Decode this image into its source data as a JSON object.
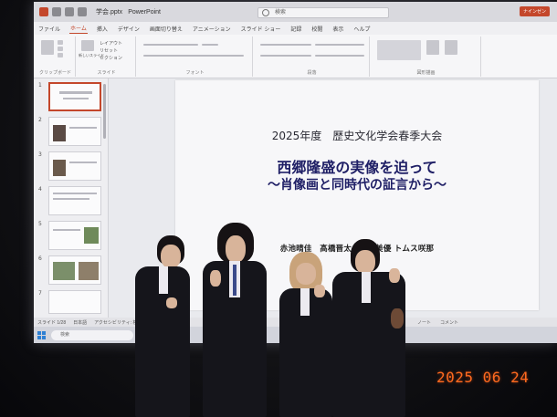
{
  "powerpoint": {
    "window": {
      "file_name": "学会.pptx",
      "app_name": "PowerPoint",
      "search_placeholder": "検索",
      "user_badge": "ナインゼン"
    },
    "tabs": [
      "ファイル",
      "ホーム",
      "挿入",
      "デザイン",
      "画面切り替え",
      "アニメーション",
      "スライド ショー",
      "記録",
      "校閲",
      "表示",
      "ヘルプ"
    ],
    "active_tab": "ホーム",
    "ribbon_groups": [
      "クリップボード",
      "スライド",
      "フォント",
      "段落",
      "図形描画"
    ],
    "ribbon_items": {
      "new_slide": "新しいスライド",
      "layout": "レイアウト",
      "reset": "リセット",
      "section": "セクション"
    },
    "thumbnail_numbers": [
      "1",
      "2",
      "3",
      "4",
      "5",
      "6",
      "7"
    ],
    "slide": {
      "year_line": "2025年度　歴史文化学会春季大会",
      "title": "西郷隆盛の実像を迫って",
      "subtitle": "〜肖像画と同時代の証言から〜",
      "authors": "赤池晴佳　髙橋晋太　　香美優 トムス咲那"
    },
    "status_bar": {
      "slide_counter": "スライド 1/28",
      "language": "日本語",
      "accessibility": "アクセシビリティ: 検討が必要です",
      "notes": "ノート",
      "comments": "コメント"
    },
    "taskbar": {
      "search_placeholder": "検索"
    }
  },
  "photo": {
    "date_stamp": "2025 06 24"
  }
}
